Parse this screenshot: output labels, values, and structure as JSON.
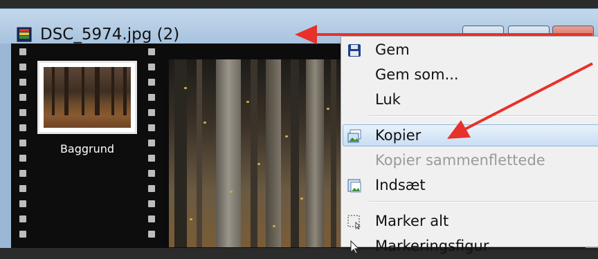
{
  "window": {
    "title": "DSC_5974.jpg (2)"
  },
  "layers": [
    {
      "label": "Baggrund"
    }
  ],
  "context_menu": {
    "items": [
      {
        "label": "Gem",
        "icon": "floppy-disk-icon",
        "enabled": true
      },
      {
        "label": "Gem som...",
        "icon": "",
        "enabled": true
      },
      {
        "label": "Luk",
        "icon": "",
        "enabled": true
      },
      {
        "label": "Kopier",
        "icon": "copy-image-icon",
        "enabled": true,
        "highlighted": true
      },
      {
        "label": "Kopier sammenflettede",
        "icon": "",
        "enabled": false
      },
      {
        "label": "Indsæt",
        "icon": "paste-image-icon",
        "enabled": true
      },
      {
        "label": "Marker alt",
        "icon": "select-all-icon",
        "enabled": true
      },
      {
        "label": "Markeringsfigur",
        "icon": "selection-cursor-icon",
        "enabled": true
      }
    ]
  },
  "annotations": {
    "arrow_color": "#e8312b"
  }
}
